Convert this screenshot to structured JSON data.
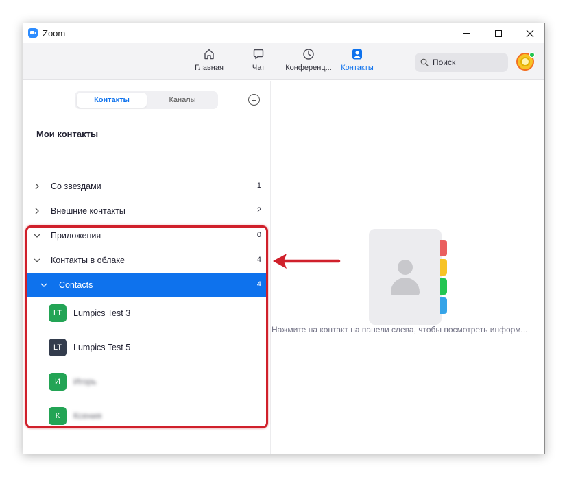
{
  "window": {
    "title": "Zoom"
  },
  "nav": {
    "items": [
      {
        "label": "Главная",
        "icon": "home-icon"
      },
      {
        "label": "Чат",
        "icon": "chat-icon"
      },
      {
        "label": "Конференц...",
        "icon": "clock-icon"
      },
      {
        "label": "Контакты",
        "icon": "contacts-icon",
        "active": true
      }
    ],
    "accent": "#0e72ed"
  },
  "search": {
    "label": "Поиск"
  },
  "sidebar": {
    "tabs": {
      "contacts": "Контакты",
      "channels": "Каналы"
    },
    "title": "Мои контакты",
    "groups": [
      {
        "label": "Со звездами",
        "count": "1",
        "expanded": false
      },
      {
        "label": "Внешние контакты",
        "count": "2",
        "expanded": false
      },
      {
        "label": "Приложения",
        "count": "0",
        "expanded": true
      },
      {
        "label": "Контакты в облаке",
        "count": "4",
        "expanded": true
      }
    ],
    "subgroup": {
      "label": "Contacts",
      "count": "4"
    },
    "contacts": [
      {
        "initials": "LT",
        "name": "Lumpics Test 3",
        "color": "#23a455"
      },
      {
        "initials": "LT",
        "name": "Lumpics Test 5",
        "color": "#333c4d"
      },
      {
        "initials": "И",
        "name": "Игорь",
        "color": "#23a455"
      },
      {
        "initials": "К",
        "name": "Ксения",
        "color": "#23a455"
      }
    ]
  },
  "main": {
    "hint": "Нажмите на контакт на панели слева, чтобы посмотреть информ...",
    "tab_colors": [
      "#ea5f5f",
      "#f7c325",
      "#23c552",
      "#35a4e8"
    ]
  },
  "annotation": {
    "color": "#d0202b"
  }
}
